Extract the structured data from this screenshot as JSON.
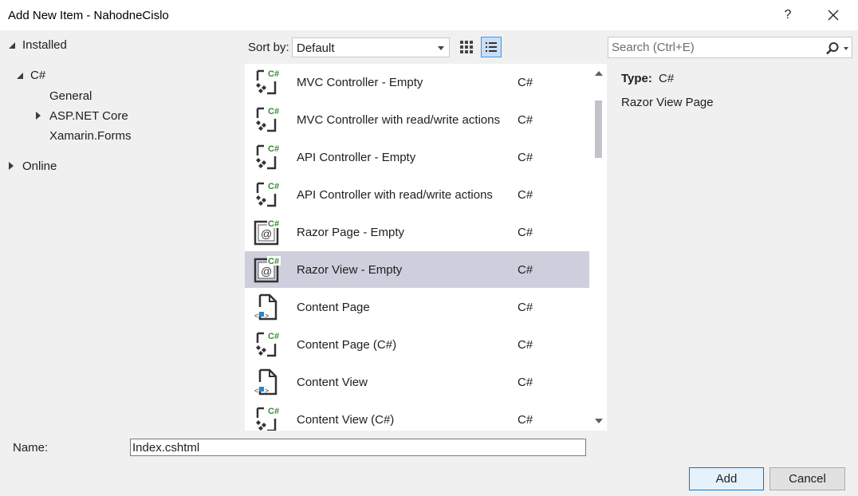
{
  "window": {
    "title": "Add New Item - NahodneCislo",
    "help_label": "?"
  },
  "tree": {
    "installed": "Installed",
    "csharp": "C#",
    "general": "General",
    "aspnet": "ASP.NET Core",
    "xamarin": "Xamarin.Forms",
    "online": "Online"
  },
  "sort": {
    "label": "Sort by:",
    "value": "Default"
  },
  "search": {
    "placeholder": "Search (Ctrl+E)"
  },
  "items": [
    {
      "name": "MVC Controller - Empty",
      "lang": "C#",
      "icon": "controller-icon"
    },
    {
      "name": "MVC Controller with read/write actions",
      "lang": "C#",
      "icon": "controller-icon"
    },
    {
      "name": "API Controller - Empty",
      "lang": "C#",
      "icon": "controller-icon"
    },
    {
      "name": "API Controller with read/write actions",
      "lang": "C#",
      "icon": "controller-icon"
    },
    {
      "name": "Razor Page - Empty",
      "lang": "C#",
      "icon": "razor-icon"
    },
    {
      "name": "Razor View - Empty",
      "lang": "C#",
      "icon": "razor-icon",
      "selected": true
    },
    {
      "name": "Content Page",
      "lang": "C#",
      "icon": "xaml-page-icon"
    },
    {
      "name": "Content Page (C#)",
      "lang": "C#",
      "icon": "controller-icon"
    },
    {
      "name": "Content View",
      "lang": "C#",
      "icon": "xaml-page-icon"
    },
    {
      "name": "Content View (C#)",
      "lang": "C#",
      "icon": "controller-icon"
    }
  ],
  "details": {
    "type_label": "Type:",
    "type_value": "C#",
    "description": "Razor View Page"
  },
  "name_field": {
    "label": "Name:",
    "value": "Index.cshtml"
  },
  "buttons": {
    "add": "Add",
    "cancel": "Cancel"
  }
}
